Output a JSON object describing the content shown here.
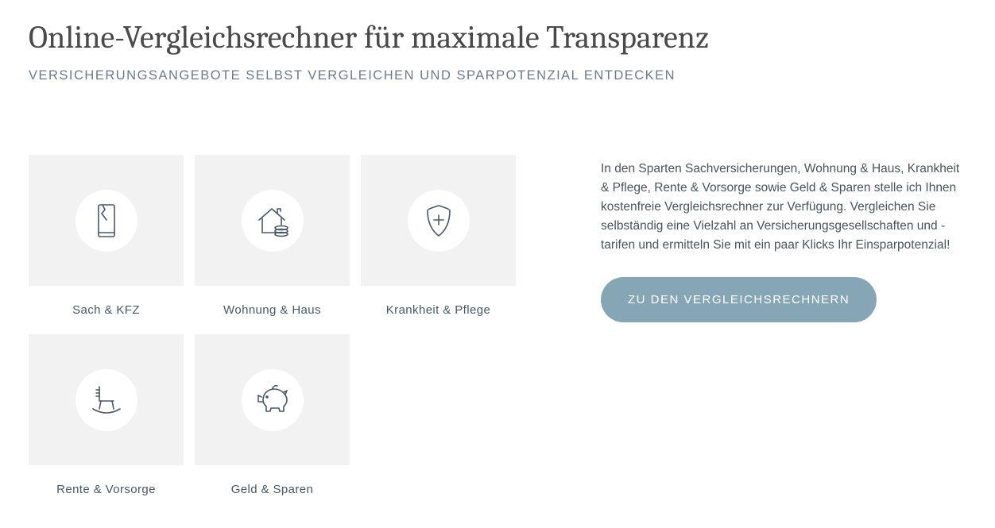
{
  "header": {
    "title": "Online-Vergleichsrechner für maximale Transparenz",
    "subtitle": "VERSICHERUNGSANGEBOTE SELBST VERGLEICHEN UND SPARPOTENZIAL ENTDECKEN"
  },
  "categories": {
    "sach_kfz": {
      "label": "Sach & KFZ"
    },
    "wohnung_haus": {
      "label": "Wohnung & Haus"
    },
    "krankheit_pflege": {
      "label": "Krankheit & Pflege"
    },
    "rente_vorsorge": {
      "label": "Rente & Vorsorge"
    },
    "geld_sparen": {
      "label": "Geld & Sparen"
    }
  },
  "side": {
    "paragraph": "In den Sparten Sachversicherungen, Wohnung & Haus, Krankheit & Pflege, Rente & Vorsorge sowie Geld & Sparen stelle ich Ihnen kostenfreie Vergleichsrechner zur Verfügung. Vergleichen Sie selbständig eine Vielzahl an Versicherungsgesellschaften und -tarifen und ermitteln Sie mit ein paar Klicks Ihr Einsparpotenzial!",
    "cta_label": "ZU DEN VERGLEICHSRECHNERN"
  }
}
